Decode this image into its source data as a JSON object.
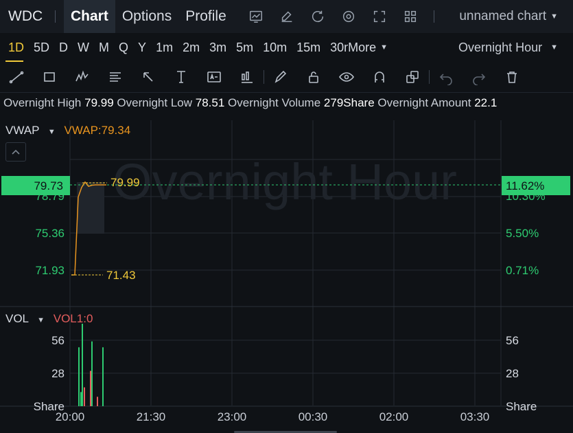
{
  "header": {
    "ticker": "WDC",
    "tabs": [
      {
        "label": "Chart",
        "active": true
      },
      {
        "label": "Options",
        "active": false
      },
      {
        "label": "Profile",
        "active": false
      }
    ],
    "icons": [
      "chart-line-icon",
      "edit-icon",
      "refresh-icon",
      "settings-icon",
      "fullscreen-icon",
      "grid-layout-icon"
    ],
    "chart_name": "unnamed chart"
  },
  "periods": {
    "items": [
      "1D",
      "5D",
      "D",
      "W",
      "M",
      "Q",
      "Y",
      "1m",
      "2m",
      "3m",
      "5m",
      "10m",
      "15m",
      "30m"
    ],
    "active": "1D",
    "more_label": "More",
    "session_label": "Overnight Hour"
  },
  "tools": [
    "trend-line-icon",
    "rectangle-icon",
    "pattern-icon",
    "fib-icon",
    "arrow-icon",
    "price-range-icon",
    "text-note-icon",
    "candle-icon",
    "pen-icon",
    "lock-icon",
    "eye-icon",
    "magnet-icon",
    "layers-icon",
    "undo-icon",
    "redo-icon",
    "trash-icon"
  ],
  "overnight": {
    "high_label": "Overnight High",
    "high": "79.99",
    "low_label": "Overnight Low",
    "low": "78.51",
    "volume_label": "Overnight Volume",
    "volume": "279Share",
    "amount_label": "Overnight Amount",
    "amount": "22.1"
  },
  "price_pane": {
    "indicator": "VWAP",
    "indicator_value": "VWAP:79.34",
    "watermark": "Overnight Hour",
    "current_price": "79.73",
    "current_pct": "11.62%",
    "high_marker": "79.99",
    "low_marker": "71.43",
    "left_ticks": [
      "78.79",
      "75.36",
      "71.93"
    ],
    "right_ticks": [
      "10.30%",
      "5.50%",
      "0.71%"
    ]
  },
  "volume_pane": {
    "indicator": "VOL",
    "indicator_value": "VOL1:0",
    "left_ticks": [
      "56",
      "28",
      "Share"
    ],
    "right_ticks": [
      "56",
      "28",
      "Share"
    ]
  },
  "time_axis": [
    "20:00",
    "21:30",
    "23:00",
    "00:30",
    "02:00",
    "03:30"
  ],
  "colors": {
    "up": "#2ecc71",
    "down": "#e35d5d",
    "vwap": "#e8941f",
    "marker": "#f0c93a",
    "active": "#f0c93a"
  },
  "chart_data": {
    "type": "line",
    "price_series": [
      71.43,
      71.43,
      78.6,
      79.5,
      79.99,
      79.6,
      79.7,
      79.73,
      79.73,
      79.73
    ],
    "volume_series": [
      {
        "v": 50,
        "up": true
      },
      {
        "v": 12,
        "up": true
      },
      {
        "v": 70,
        "up": true
      },
      {
        "v": 16,
        "up": false
      },
      {
        "v": 55,
        "up": true
      },
      {
        "v": 30,
        "up": false
      },
      {
        "v": 8,
        "up": false
      },
      {
        "v": 50,
        "up": true
      }
    ]
  }
}
